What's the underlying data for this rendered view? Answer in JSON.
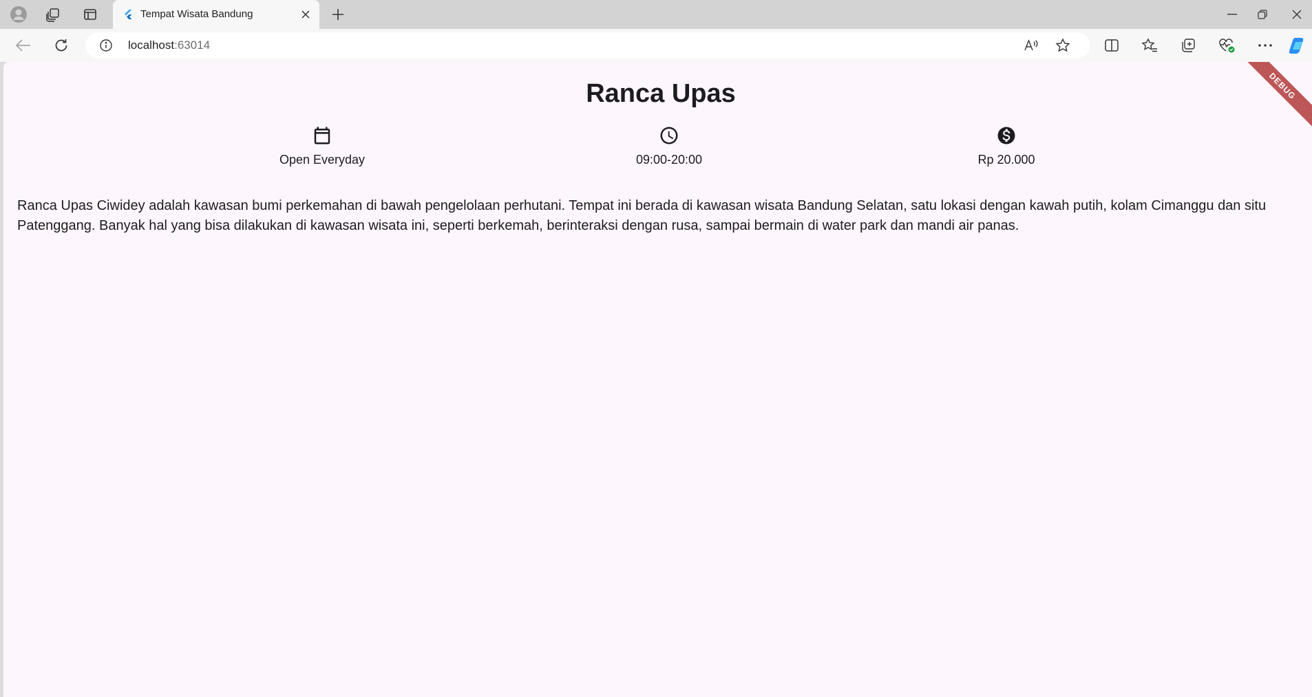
{
  "browser": {
    "tab": {
      "title": "Tempat Wisata Bandung",
      "favicon": "flutter-icon"
    },
    "url_host": "localhost",
    "url_port": ":63014",
    "colors": {
      "tab_strip": "#d3d3d3",
      "toolbar": "#f7f7f7",
      "flutter_blue": "#42a5f5"
    },
    "icons": [
      "profile-icon",
      "workspaces-icon",
      "tab-actions-icon",
      "close-icon",
      "new-tab-icon",
      "minimize-icon",
      "restore-icon",
      "window-close-icon",
      "back-icon",
      "refresh-icon",
      "info-icon",
      "read-aloud-icon",
      "favorite-star-icon",
      "split-screen-icon",
      "favorites-icon",
      "collections-icon",
      "browser-essentials-icon",
      "more-icon",
      "copilot-icon"
    ]
  },
  "page": {
    "debug_banner": "DEBUG",
    "title": "Ranca Upas",
    "info": [
      {
        "icon": "calendar-icon",
        "label": "Open Everyday"
      },
      {
        "icon": "clock-icon",
        "label": "09:00-20:00"
      },
      {
        "icon": "dollar-icon",
        "label": "Rp 20.000"
      }
    ],
    "description": "Ranca Upas Ciwidey adalah kawasan bumi perkemahan di bawah pengelolaan perhutani. Tempat ini berada di kawasan wisata Bandung Selatan, satu lokasi dengan kawah putih, kolam Cimanggu dan situ Patenggang. Banyak hal yang bisa dilakukan di kawasan wisata ini, seperti berkemah, berinteraksi dengan rusa, sampai bermain di water park dan mandi air panas.",
    "colors": {
      "background": "#fdf7fd",
      "text": "#1d1b20",
      "debug": "#b23a3a"
    }
  }
}
